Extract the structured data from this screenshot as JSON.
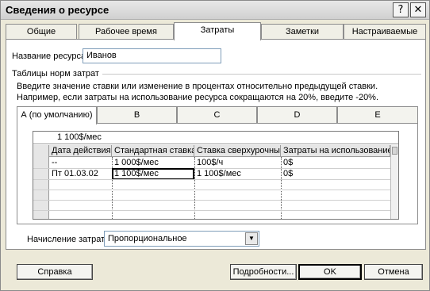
{
  "window": {
    "title": "Сведения о ресурсе",
    "help_glyph": "?",
    "close_glyph": "✕"
  },
  "tabs": [
    {
      "label": "Общие"
    },
    {
      "label": "Рабочее время"
    },
    {
      "label": "Затраты"
    },
    {
      "label": "Заметки"
    },
    {
      "label": "Настраиваемые поля"
    }
  ],
  "resource": {
    "label": "Название ресурса:",
    "value": "Иванов"
  },
  "rates": {
    "group_label": "Таблицы норм затрат",
    "hint": "Введите значение ставки или изменение в процентах относительно предыдущей ставки. Например, если затраты на использование ресурса сокращаются на 20%, введите -20%.",
    "tabs": [
      {
        "label": "А (по умолчанию)"
      },
      {
        "label": "B"
      },
      {
        "label": "C"
      },
      {
        "label": "D"
      },
      {
        "label": "E"
      }
    ],
    "edit_value": "1 100$/мес",
    "columns": [
      "Дата действия",
      "Стандартная ставка",
      "Ставка сверхурочных",
      "Затраты на использование"
    ],
    "rows": [
      [
        "--",
        "1 000$/мес",
        "100$/ч",
        "0$"
      ],
      [
        "Пт 01.03.02",
        "1 100$/мес",
        "1 100$/мес",
        "0$"
      ]
    ]
  },
  "accrual": {
    "label": "Начисление затрат:",
    "value": "Пропорциональное"
  },
  "buttons": {
    "help": "Справка",
    "details": "Подробности...",
    "ok": "OK",
    "cancel": "Отмена"
  }
}
